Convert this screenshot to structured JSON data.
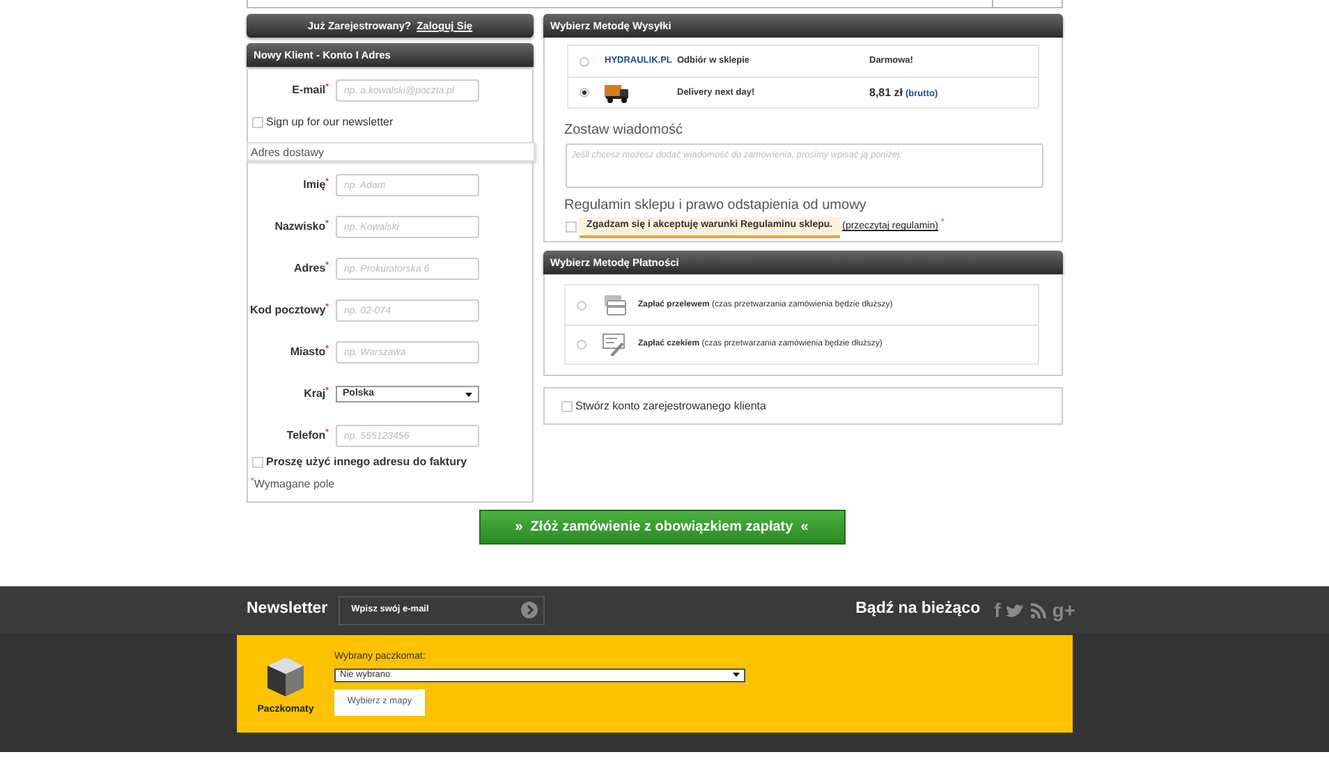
{
  "login_bar": {
    "text": "Już Zarejestrowany?",
    "link": "Zaloguj Się"
  },
  "customer_panel": {
    "title": "Nowy Klient - Konto I Adres",
    "email": {
      "label": "E-mail$^{*}$",
      "placeholder": "np. a.kowalski@poczta.pl"
    },
    "newsletter": {
      "label": "Sign up for our newsletter",
      "checked": false
    },
    "section": "Adres dostawy",
    "fields": [
      {
        "kind": "text",
        "label": "Imię$^{*}$",
        "placeholder": "np. Adam"
      },
      {
        "kind": "text",
        "label": "Nazwisko$^{*}$",
        "placeholder": "np. Kowalski"
      },
      {
        "kind": "text",
        "label": "Adres$^{*}$",
        "placeholder": "np. Prokuratorska 6"
      },
      {
        "kind": "text",
        "label": "Kod pocztowy$^{*}$",
        "placeholder": "np. 02-074"
      },
      {
        "kind": "text",
        "label": "Miasto$^{*}$",
        "placeholder": "np. Warszawa"
      },
      {
        "kind": "select",
        "label": "Kraj$^{*}$",
        "value": "Polska"
      },
      {
        "kind": "text",
        "label": "Telefon$^{*}$",
        "placeholder": "np. 555123456"
      }
    ],
    "other_address": {
      "label": "Proszę użyć innego adresu do faktury",
      "checked": false
    },
    "required_note": "$^{*}$Wymagane pole"
  },
  "shipping_panel": {
    "title": "Wybierz Metodę Wysyłki",
    "options": [
      {
        "kind": "store",
        "selected": false,
        "carrier": "HYDRAULIK.PL",
        "name": "Odbiór w sklepie",
        "price": "Darmowa!"
      },
      {
        "kind": "courier",
        "selected": true,
        "name": "Delivery next day!",
        "price": "8,81 zł",
        "price_note": "(brutto)"
      }
    ],
    "message_heading": "Zostaw wiadomość",
    "message_placeholder": "Jeśli chcesz możesz dodać wiadomość do zamówienia, prosimy wpisać ją poniżej.",
    "terms_heading": "Regulamin sklepu i prawo odstapienia od umowy",
    "terms": {
      "checked": false,
      "label": "Zgadzam się i akceptuję warunki Regulaminu sklepu.",
      "link": "(przeczytaj regulamin)",
      "mark": "*"
    }
  },
  "payment_panel": {
    "title": "Wybierz Metodę Płatności",
    "options": [
      {
        "kind": "card",
        "selected": false,
        "label": "Zapłać przelewem",
        "note": "(czas przetwarzania zamówienia będzie dłuższy)"
      },
      {
        "kind": "cheque",
        "selected": false,
        "label": "Zapłać czekiem",
        "note": "(czas przetwarzania zamówienia będzie dłuższy)"
      }
    ]
  },
  "account": {
    "label": "Stwórz konto zarejestrowanego klienta",
    "checked": false
  },
  "submit": "»  Złóż zamówienie z obowiązkiem zapłaty  «",
  "footer": {
    "newsletter_title": "Newsletter",
    "newsletter_placeholder": "Wpisz swój e-mail",
    "follow": "Bądź na bieżąco",
    "social": [
      {
        "kind": "letter",
        "text": "f"
      },
      {
        "kind": "bird"
      },
      {
        "kind": "rss"
      },
      {
        "kind": "letter",
        "text": "g+"
      }
    ]
  },
  "parcel": {
    "logo_label": "Paczkomaty",
    "label": "Wybrany paczkomat:",
    "value": "Nie wybrano",
    "button": "Wybierz z mapy"
  }
}
